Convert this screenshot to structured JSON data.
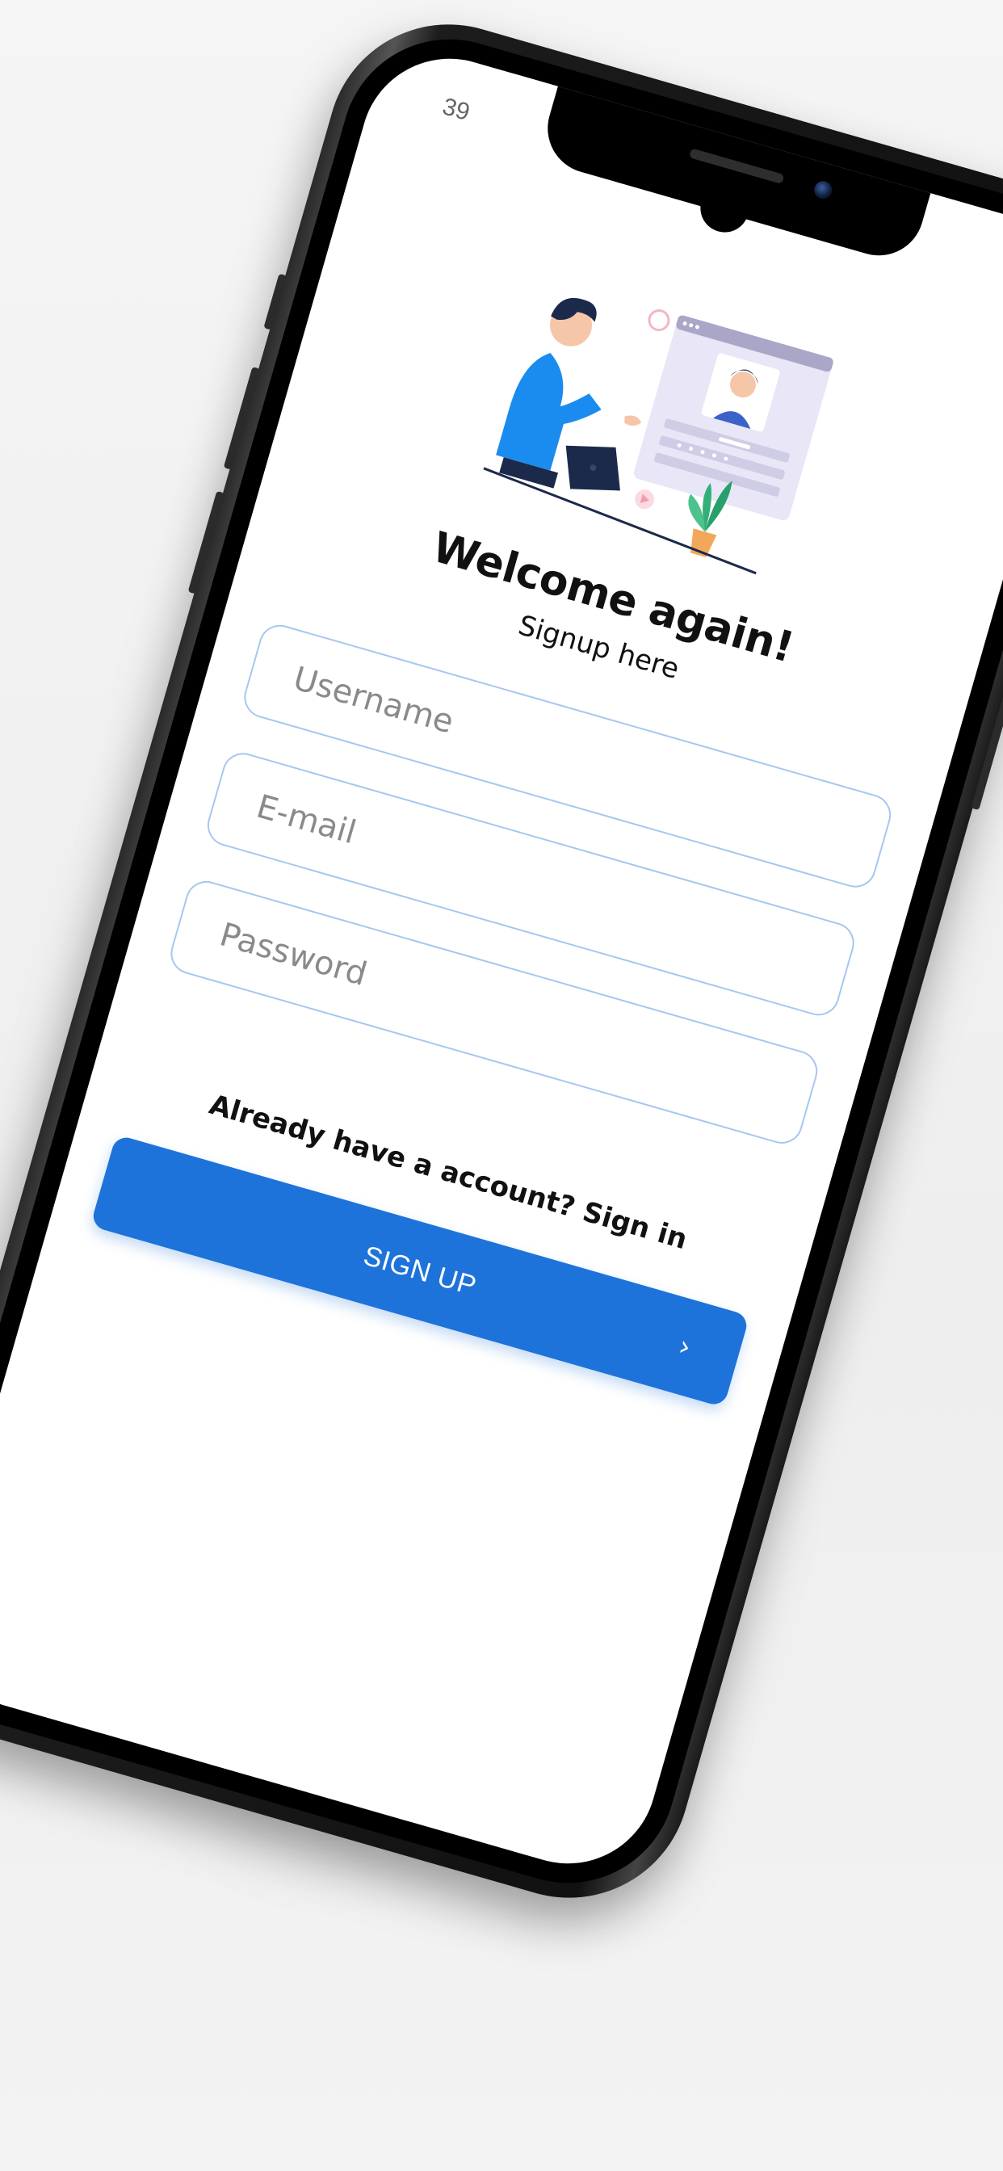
{
  "status_bar": {
    "time": "39"
  },
  "header": {
    "title": "Welcome again!",
    "subtitle": "Signup here"
  },
  "form": {
    "username_placeholder": "Username",
    "email_placeholder": "E-mail",
    "password_placeholder": "Password"
  },
  "footer": {
    "account_prompt": "Already have a account? Sign in",
    "signup_label": "SIGN UP",
    "signup_icon": "chevron-right-icon"
  },
  "colors": {
    "accent": "#1e73da",
    "field_border": "#a7c7ee",
    "placeholder": "#8a8a8a"
  }
}
